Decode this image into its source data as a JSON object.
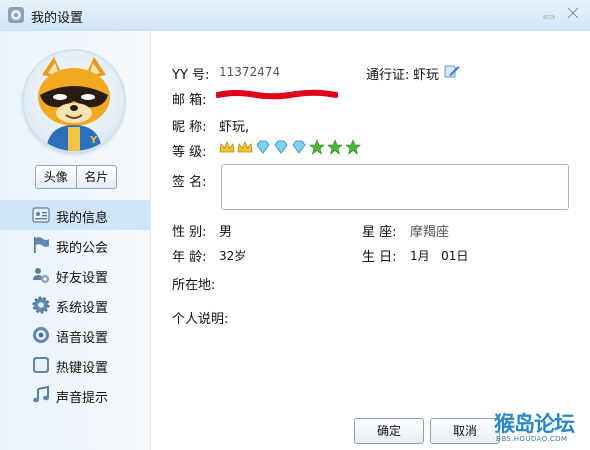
{
  "window": {
    "title": "我的设置"
  },
  "left": {
    "avatar_tabs": [
      "头像",
      "名片"
    ],
    "nav": [
      {
        "label": "我的信息",
        "icon": "id-card-icon",
        "active": true
      },
      {
        "label": "我的公会",
        "icon": "flag-icon"
      },
      {
        "label": "好友设置",
        "icon": "users-gear-icon"
      },
      {
        "label": "系统设置",
        "icon": "gear-icon"
      },
      {
        "label": "语音设置",
        "icon": "speaker-icon"
      },
      {
        "label": "热键设置",
        "icon": "keyboard-icon"
      },
      {
        "label": "声音提示",
        "icon": "music-note-icon"
      }
    ]
  },
  "profile": {
    "yy_label": "YY  号:",
    "yy_value": "11372474",
    "passport_label": "通行证:",
    "passport_value": "虾玩",
    "email_label": "邮  箱:",
    "nickname_label": "昵  称:",
    "nickname_value": "虾玩,",
    "level_label": "等  级:",
    "signature_label": "签  名:",
    "gender_label": "性  别:",
    "gender_value": "男",
    "zodiac_label": "星  座:",
    "zodiac_value": "摩羯座",
    "age_label": "年  龄:",
    "age_value": "32岁",
    "birthday_label": "生  日:",
    "birthday_value": "1月   01日",
    "location_label": "所在地:",
    "bio_label": "个人说明:"
  },
  "buttons": {
    "ok": "确定",
    "cancel": "取消"
  },
  "watermark": {
    "main": "猴岛论坛",
    "sub": "BBS.HOUDAO.COM"
  },
  "colors": {
    "nav_active": "#cfe5f9",
    "accent": "#3a83c9",
    "redact": "#e0001a"
  }
}
